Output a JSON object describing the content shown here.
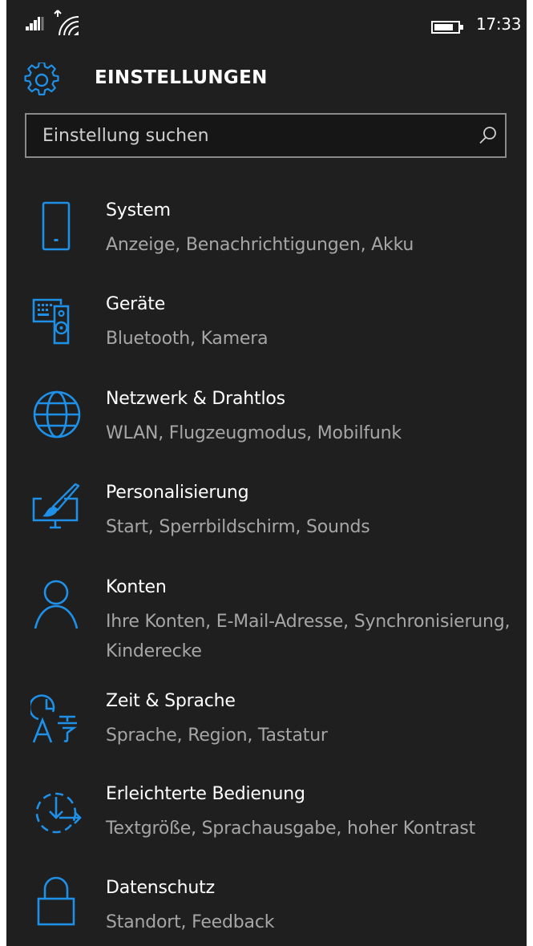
{
  "status": {
    "time": "17:33"
  },
  "header": {
    "title": "EINSTELLUNGEN"
  },
  "search": {
    "placeholder": "Einstellung suchen"
  },
  "items": [
    {
      "label": "System",
      "sub": "Anzeige, Benachrichtigungen, Akku",
      "icon": "phone-icon"
    },
    {
      "label": "Geräte",
      "sub": "Bluetooth, Kamera",
      "icon": "devices-icon"
    },
    {
      "label": "Netzwerk & Drahtlos",
      "sub": "WLAN, Flugzeugmodus, Mobilfunk",
      "icon": "globe-icon"
    },
    {
      "label": "Personalisierung",
      "sub": "Start, Sperrbildschirm, Sounds",
      "icon": "paintbrush-icon"
    },
    {
      "label": "Konten",
      "sub": "Ihre Konten, E-Mail-Adresse, Synchronisierung, Kinderecke",
      "icon": "person-icon"
    },
    {
      "label": "Zeit & Sprache",
      "sub": "Sprache, Region, Tastatur",
      "icon": "time-language-icon"
    },
    {
      "label": "Erleichterte Bedienung",
      "sub": "Textgröße, Sprachausgabe, hoher Kontrast",
      "icon": "ease-of-access-icon"
    },
    {
      "label": "Datenschutz",
      "sub": "Standort, Feedback",
      "icon": "lock-icon"
    }
  ],
  "colors": {
    "accent": "#1e90e8",
    "background": "#1f1f1f",
    "subtext": "#a6a6a6"
  }
}
